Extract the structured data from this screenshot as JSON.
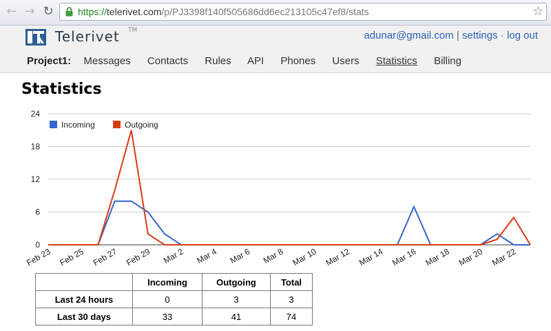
{
  "browser": {
    "url_scheme": "https://",
    "url_host": "telerivet.com",
    "url_path": "/p/PJ3398f140f505686dd6ec213105c47ef8/stats"
  },
  "header": {
    "logo_text": "Telerivet",
    "trademark": "TM",
    "user_email": "adunar@gmail.com",
    "settings_label": "settings",
    "logout_label": "log out",
    "sep1": "|",
    "sep2": "·"
  },
  "nav": {
    "project_label": "Project1:",
    "items": [
      {
        "label": "Messages"
      },
      {
        "label": "Contacts"
      },
      {
        "label": "Rules"
      },
      {
        "label": "API"
      },
      {
        "label": "Phones"
      },
      {
        "label": "Users"
      },
      {
        "label": "Statistics"
      },
      {
        "label": "Billing"
      }
    ],
    "active_index": 6
  },
  "page": {
    "title": "Statistics"
  },
  "chart_data": {
    "type": "line",
    "x": [
      "Feb 23",
      "Feb 24",
      "Feb 25",
      "Feb 26",
      "Feb 27",
      "Feb 28",
      "Feb 29",
      "Mar 1",
      "Mar 2",
      "Mar 3",
      "Mar 4",
      "Mar 5",
      "Mar 6",
      "Mar 7",
      "Mar 8",
      "Mar 9",
      "Mar 10",
      "Mar 11",
      "Mar 12",
      "Mar 13",
      "Mar 14",
      "Mar 15",
      "Mar 16",
      "Mar 17",
      "Mar 18",
      "Mar 19",
      "Mar 20",
      "Mar 21",
      "Mar 22",
      "Mar 23"
    ],
    "tick_labels": [
      "Feb 23",
      "Feb 25",
      "Feb 27",
      "Feb 29",
      "Mar 2",
      "Mar 4",
      "Mar 6",
      "Mar 8",
      "Mar 10",
      "Mar 12",
      "Mar 14",
      "Mar 16",
      "Mar 18",
      "Mar 20",
      "Mar 22"
    ],
    "series": [
      {
        "name": "Incoming",
        "color": "#3366cc",
        "values": [
          0,
          0,
          0,
          0,
          8,
          8,
          6,
          2,
          0,
          0,
          0,
          0,
          0,
          0,
          0,
          0,
          0,
          0,
          0,
          0,
          0,
          0,
          7,
          0,
          0,
          0,
          0,
          2,
          0,
          0
        ]
      },
      {
        "name": "Outgoing",
        "color": "#dc3912",
        "values": [
          0,
          0,
          0,
          0,
          10,
          21,
          2,
          0,
          0,
          0,
          0,
          0,
          0,
          0,
          0,
          0,
          0,
          0,
          0,
          0,
          0,
          0,
          0,
          0,
          0,
          0,
          0,
          1,
          5,
          0
        ]
      }
    ],
    "ylim": [
      0,
      24
    ],
    "yticks": [
      0,
      6,
      12,
      18,
      24
    ],
    "legend_position": "top-left",
    "grid": true
  },
  "table": {
    "headers": [
      "",
      "Incoming",
      "Outgoing",
      "Total"
    ],
    "rows": [
      {
        "label": "Last 24 hours",
        "values": [
          "0",
          "3",
          "3"
        ]
      },
      {
        "label": "Last 30 days",
        "values": [
          "33",
          "41",
          "74"
        ]
      }
    ]
  }
}
